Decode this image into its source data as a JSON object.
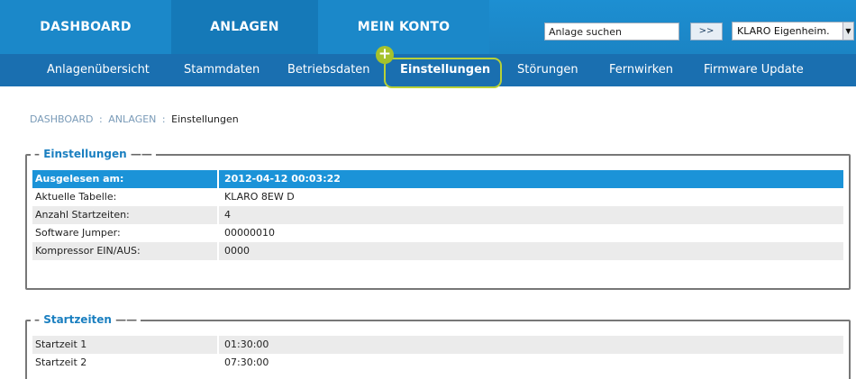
{
  "main_nav": {
    "dashboard": "DASHBOARD",
    "anlagen": "ANLAGEN",
    "mein_konto": "MEIN KONTO"
  },
  "search": {
    "value": "Anlage suchen",
    "button_label": ">>"
  },
  "account": {
    "selected": "KLARO Eigenheim.",
    "arrow_icon": "chevron-down-icon"
  },
  "sub_nav": {
    "items": [
      "Anlagenübersicht",
      "Stammdaten",
      "Betriebsdaten",
      "Einstellungen",
      "Störungen",
      "Fernwirken",
      "Firmware Update"
    ],
    "active_index": 3,
    "plus_badge": "+"
  },
  "breadcrumb": {
    "dashboard": "DASHBOARD",
    "sep1": ":",
    "anlagen": "ANLAGEN",
    "sep2": ":",
    "current": "Einstellungen"
  },
  "einstellungen": {
    "legend": "Einstellungen",
    "rows": [
      {
        "label": "Ausgelesen am:",
        "value": "2012-04-12 00:03:22"
      },
      {
        "label": "Aktuelle Tabelle:",
        "value": "KLARO 8EW D"
      },
      {
        "label": "Anzahl Startzeiten:",
        "value": "4"
      },
      {
        "label": "Software Jumper:",
        "value": "00000010"
      },
      {
        "label": "Kompressor EIN/AUS:",
        "value": "0000"
      }
    ]
  },
  "startzeiten": {
    "legend": "Startzeiten",
    "rows": [
      {
        "label": "Startzeit 1",
        "value": "01:30:00"
      },
      {
        "label": "Startzeit 2",
        "value": "07:30:00"
      }
    ]
  },
  "colors": {
    "nav_blue": "#1b88c9",
    "subnav_blue": "#1a6fb0",
    "header_row": "#1b93d8",
    "highlight": "#b8d137"
  }
}
